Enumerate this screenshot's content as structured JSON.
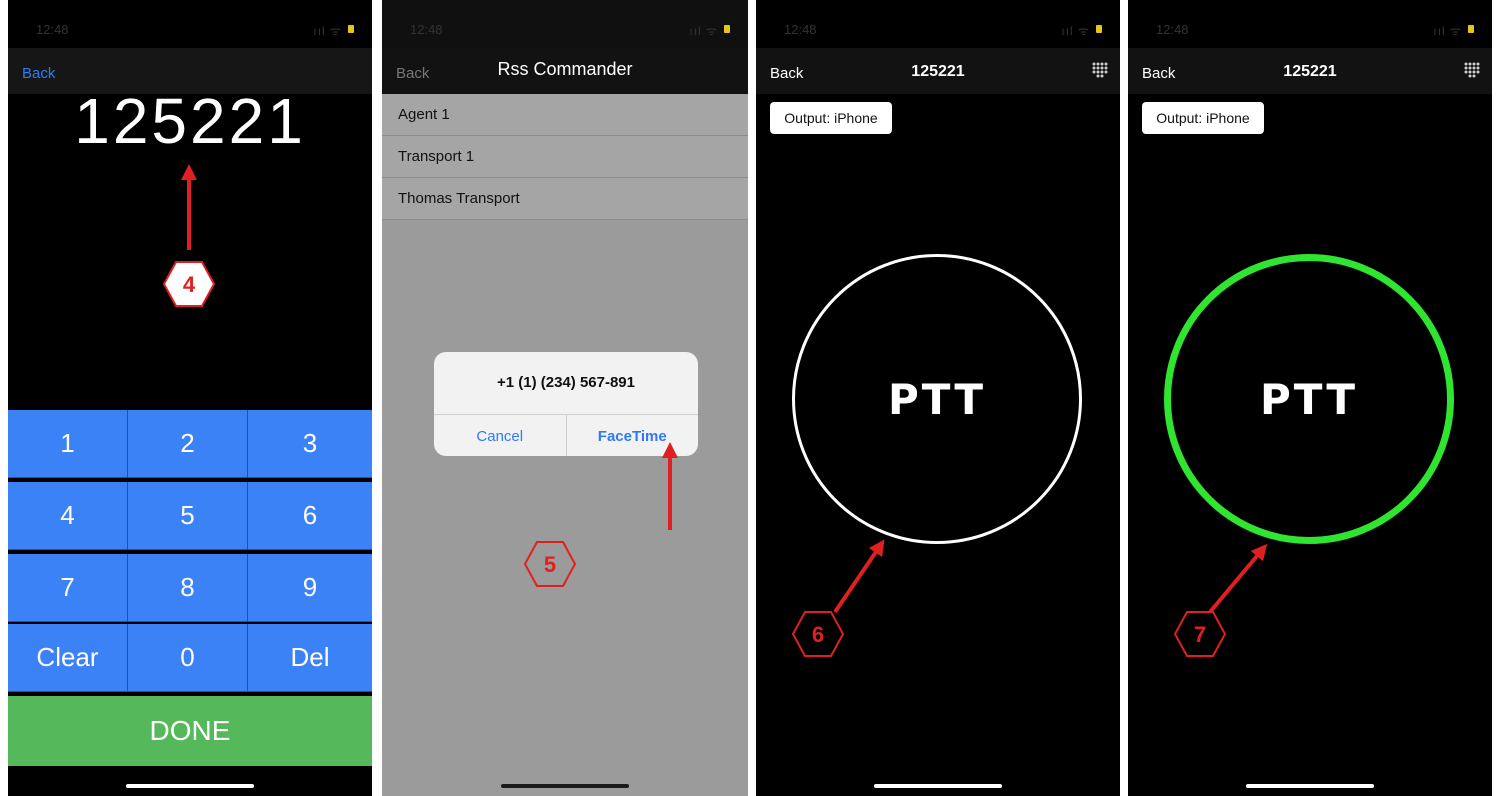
{
  "status": {
    "time": "12:48",
    "signal": "ııl ᯤ"
  },
  "panel1": {
    "back_label": "Back",
    "code": "125221",
    "keys": [
      "1",
      "2",
      "3",
      "4",
      "5",
      "6",
      "7",
      "8",
      "9",
      "Clear",
      "0",
      "Del"
    ],
    "done_label": "DONE"
  },
  "panel2": {
    "back_label": "Back",
    "title": "Rss Commander",
    "contacts": [
      "Agent 1",
      "Transport 1",
      "Thomas Transport"
    ],
    "dialog": {
      "number": "+1 (1) (234) 567-891",
      "cancel_label": "Cancel",
      "facetime_label": "FaceTime"
    }
  },
  "panel3": {
    "back_label": "Back",
    "title": "125221",
    "output_label": "Output: iPhone",
    "ptt_label": "PTT",
    "ring_color": "#ffffff"
  },
  "panel4": {
    "back_label": "Back",
    "title": "125221",
    "output_label": "Output: iPhone",
    "ptt_label": "PTT",
    "ring_color": "#2fe52f"
  },
  "annotations": {
    "step4": "4",
    "step5": "5",
    "step6": "6",
    "step7": "7",
    "color": "#e02020"
  }
}
